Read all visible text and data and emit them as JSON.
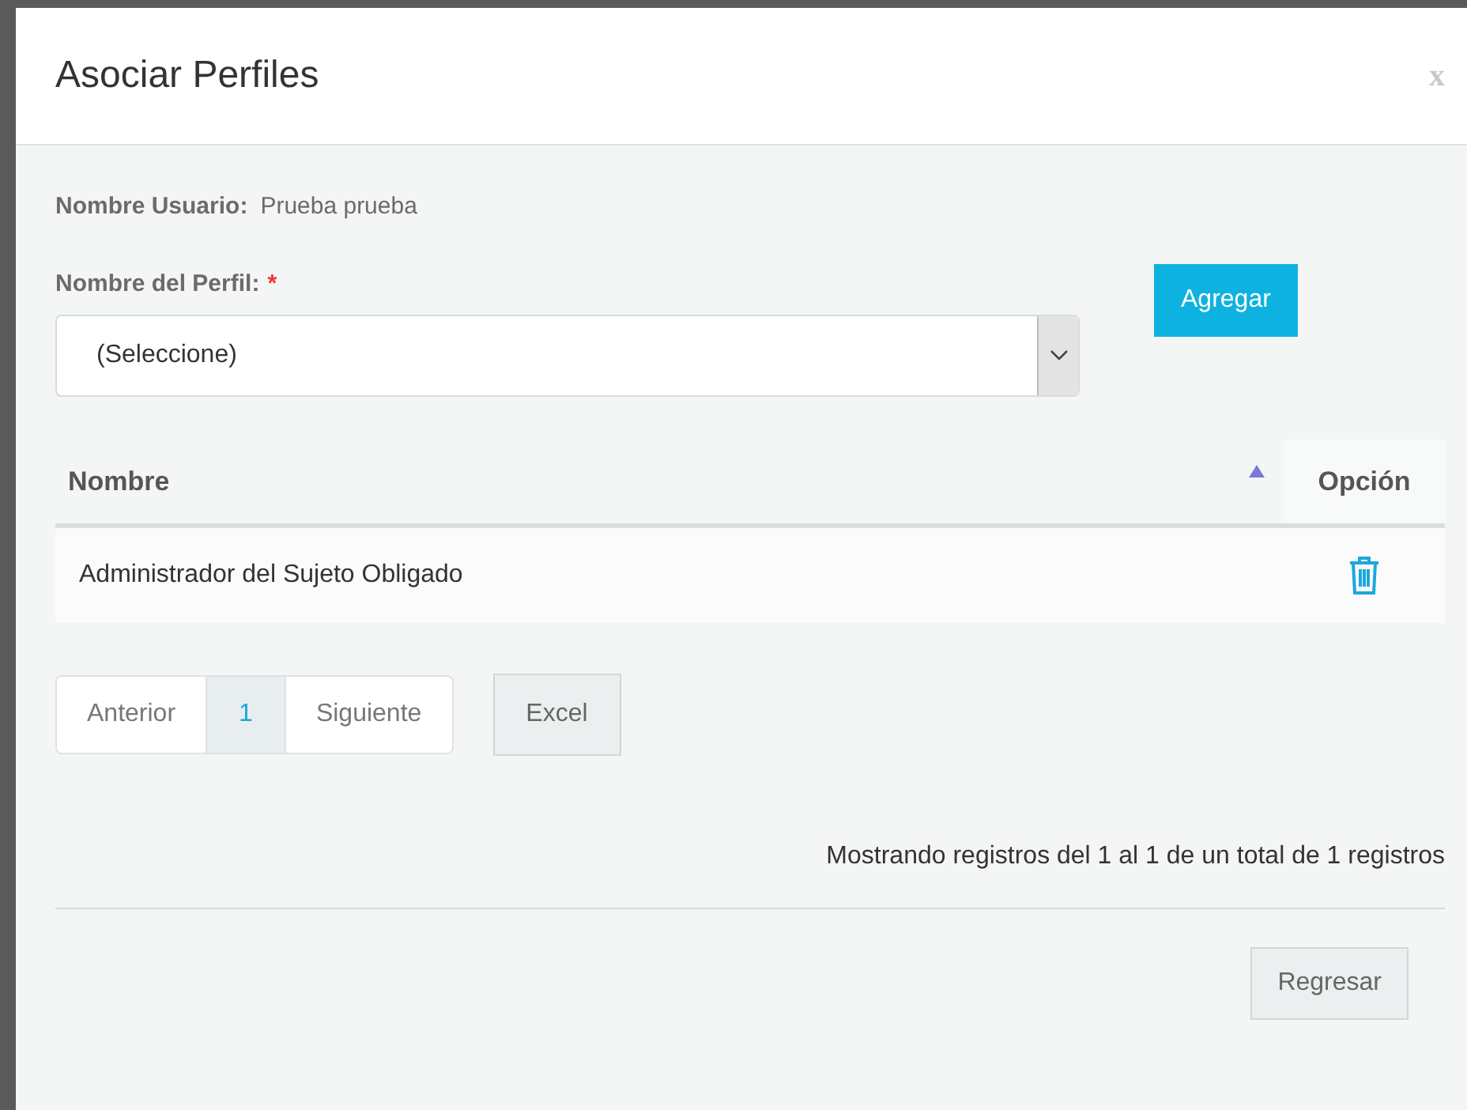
{
  "dialog": {
    "title": "Asociar Perfiles",
    "close": "x"
  },
  "user": {
    "label": "Nombre Usuario:",
    "value": "Prueba prueba"
  },
  "profile_field": {
    "label": "Nombre del Perfil:",
    "required_mark": "*",
    "value": "(Seleccione)"
  },
  "add_button": "Agregar",
  "table": {
    "columns": [
      {
        "label": "Nombre",
        "sorted": true
      },
      {
        "label": "Opción",
        "sorted": false
      }
    ],
    "rows": [
      {
        "name": "Administrador del Sujeto Obligado"
      }
    ]
  },
  "pagination": {
    "previous": "Anterior",
    "next": "Siguiente",
    "pages": [
      {
        "label": "1",
        "selected": true
      }
    ]
  },
  "excel_button": "Excel",
  "summary": "Mostrando registros del 1 al 1 de un total de 1 registros",
  "back_button": "Regresar"
}
